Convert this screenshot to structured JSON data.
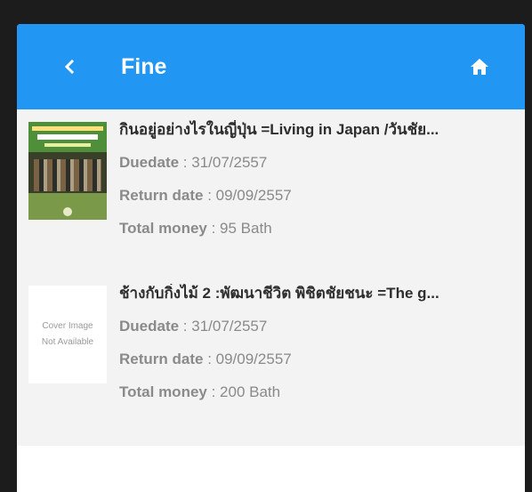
{
  "header": {
    "title": "Fine",
    "back_icon": "chevron-left-icon",
    "home_icon": "home-icon",
    "color": "#2196f3"
  },
  "labels": {
    "duedate": "Duedate",
    "return_date": "Return date",
    "total_money": "Total money",
    "separator": " : "
  },
  "items": [
    {
      "title": "กินอยู่อย่างไรในญี่ปุ่น =Living in Japan /วันชัย...",
      "duedate": "31/07/2557",
      "return_date": "09/09/2557",
      "total_money": "95 Bath",
      "cover": "image"
    },
    {
      "title": "ช้างกับกิ่งไม้ 2 :พัฒนาชีวิต พิชิตชัยชนะ =The g...",
      "duedate": "31/07/2557",
      "return_date": "09/09/2557",
      "total_money": "200 Bath",
      "cover": "none",
      "cover_placeholder_line1": "Cover Image",
      "cover_placeholder_line2": "Not Available"
    }
  ]
}
